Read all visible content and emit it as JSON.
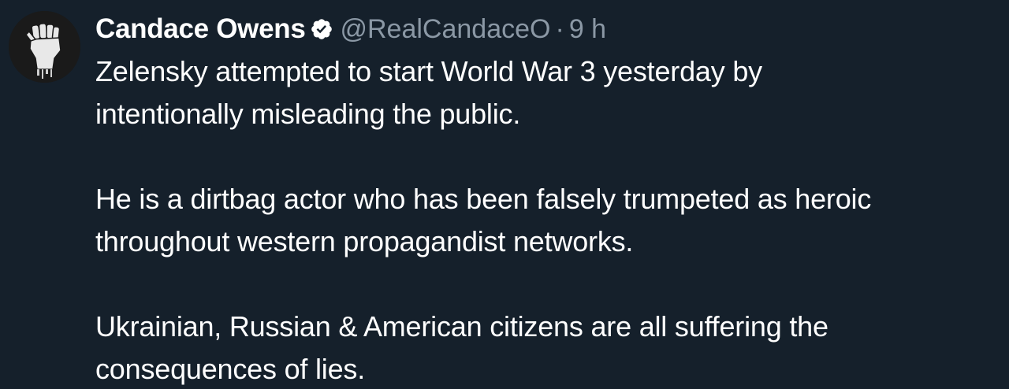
{
  "tweet": {
    "author": {
      "name": "Candace Owens",
      "handle": "@RealCandaceO",
      "verified_icon": "verified-badge-icon",
      "avatar_icon": "raised-fist-icon"
    },
    "separator": "·",
    "time": "9 h",
    "paragraphs": [
      {
        "lines": [
          "Zelensky attempted to start World War 3 yesterday by",
          "intentionally misleading the public."
        ]
      },
      {
        "lines": [
          "He is a dirtbag actor who has been falsely trumpeted as heroic",
          "throughout western propagandist networks."
        ]
      },
      {
        "lines": [
          "Ukrainian, Russian & American citizens are all suffering the",
          "consequences of lies."
        ]
      }
    ]
  },
  "colors": {
    "background": "#15202b",
    "text_primary": "#ffffff",
    "text_secondary": "#8b98a5",
    "verified_badge": "#ffffff"
  }
}
